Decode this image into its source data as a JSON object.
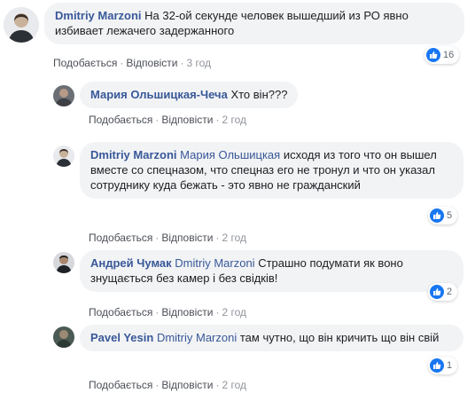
{
  "actions": {
    "like_label": "Подобається",
    "reply_label": "Відповісти",
    "separator": "·"
  },
  "comments": [
    {
      "author": "Dmitriy Marzoni",
      "tag": "",
      "text": "На 32-ой секунде человек вышедший из РО явно избивает лежачего задержанного",
      "time": "3 год",
      "reactions": "16"
    },
    {
      "author": "Мария Ольшицкая-Чеча",
      "tag": "",
      "text": "Хто він???",
      "time": "2 год",
      "reactions": ""
    },
    {
      "author": "Dmitriy Marzoni",
      "tag": "Мария Ольшицкая",
      "text": "исходя из того что он вышел вместе со спецназом, что спецназ его не тронул и что он указал сотруднику куда бежать - это явно не гражданский",
      "time": "2 год",
      "reactions": "5"
    },
    {
      "author": "Андрей Чумак",
      "tag": "Dmitriy Marzoni",
      "text": "Страшно подумати як воно знущається без камер і без свідків!",
      "time": "2 год",
      "reactions": "2"
    },
    {
      "author": "Pavel Yesin",
      "tag": "Dmitriy Marzoni",
      "text": "там чутно, що він кричить що він свій",
      "time": "2 год",
      "reactions": "1"
    }
  ],
  "colors": {
    "author": "#385898",
    "bubble": "#f2f3f5",
    "like": "#1877f2",
    "meta": "#90949c"
  },
  "icons": {
    "reaction": "thumbs-up-icon"
  }
}
